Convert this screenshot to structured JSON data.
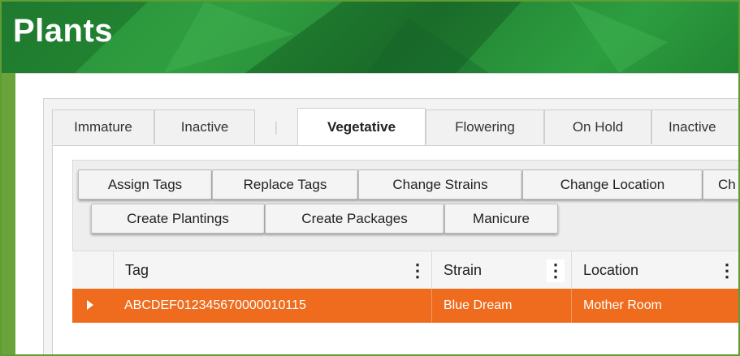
{
  "page": {
    "title": "Plants"
  },
  "colors": {
    "hero_green": "#2a9a3a",
    "accent_orange": "#ef6c1e",
    "frame_green": "#5f9c33"
  },
  "tabs": [
    {
      "label": "Immature"
    },
    {
      "label": "Inactive"
    },
    {
      "label": "|"
    },
    {
      "label": "Vegetative",
      "active": true
    },
    {
      "label": "Flowering"
    },
    {
      "label": "On Hold"
    },
    {
      "label": "Inactive"
    }
  ],
  "toolbar": {
    "row1": [
      "Assign Tags",
      "Replace Tags",
      "Change Strains",
      "Change Location",
      "Ch"
    ],
    "row2": [
      "Create Plantings",
      "Create Packages",
      "Manicure"
    ]
  },
  "grid": {
    "columns": [
      {
        "label": "Tag",
        "menu_icon": "kebab-icon"
      },
      {
        "label": "Strain",
        "menu_icon": "kebab-icon"
      },
      {
        "label": "Location",
        "menu_icon": "kebab-icon"
      }
    ],
    "rows": [
      {
        "tag": "ABCDEF012345670000010115",
        "strain": "Blue Dream",
        "location": "Mother Room",
        "expand_icon": "caret-right-icon"
      }
    ]
  }
}
